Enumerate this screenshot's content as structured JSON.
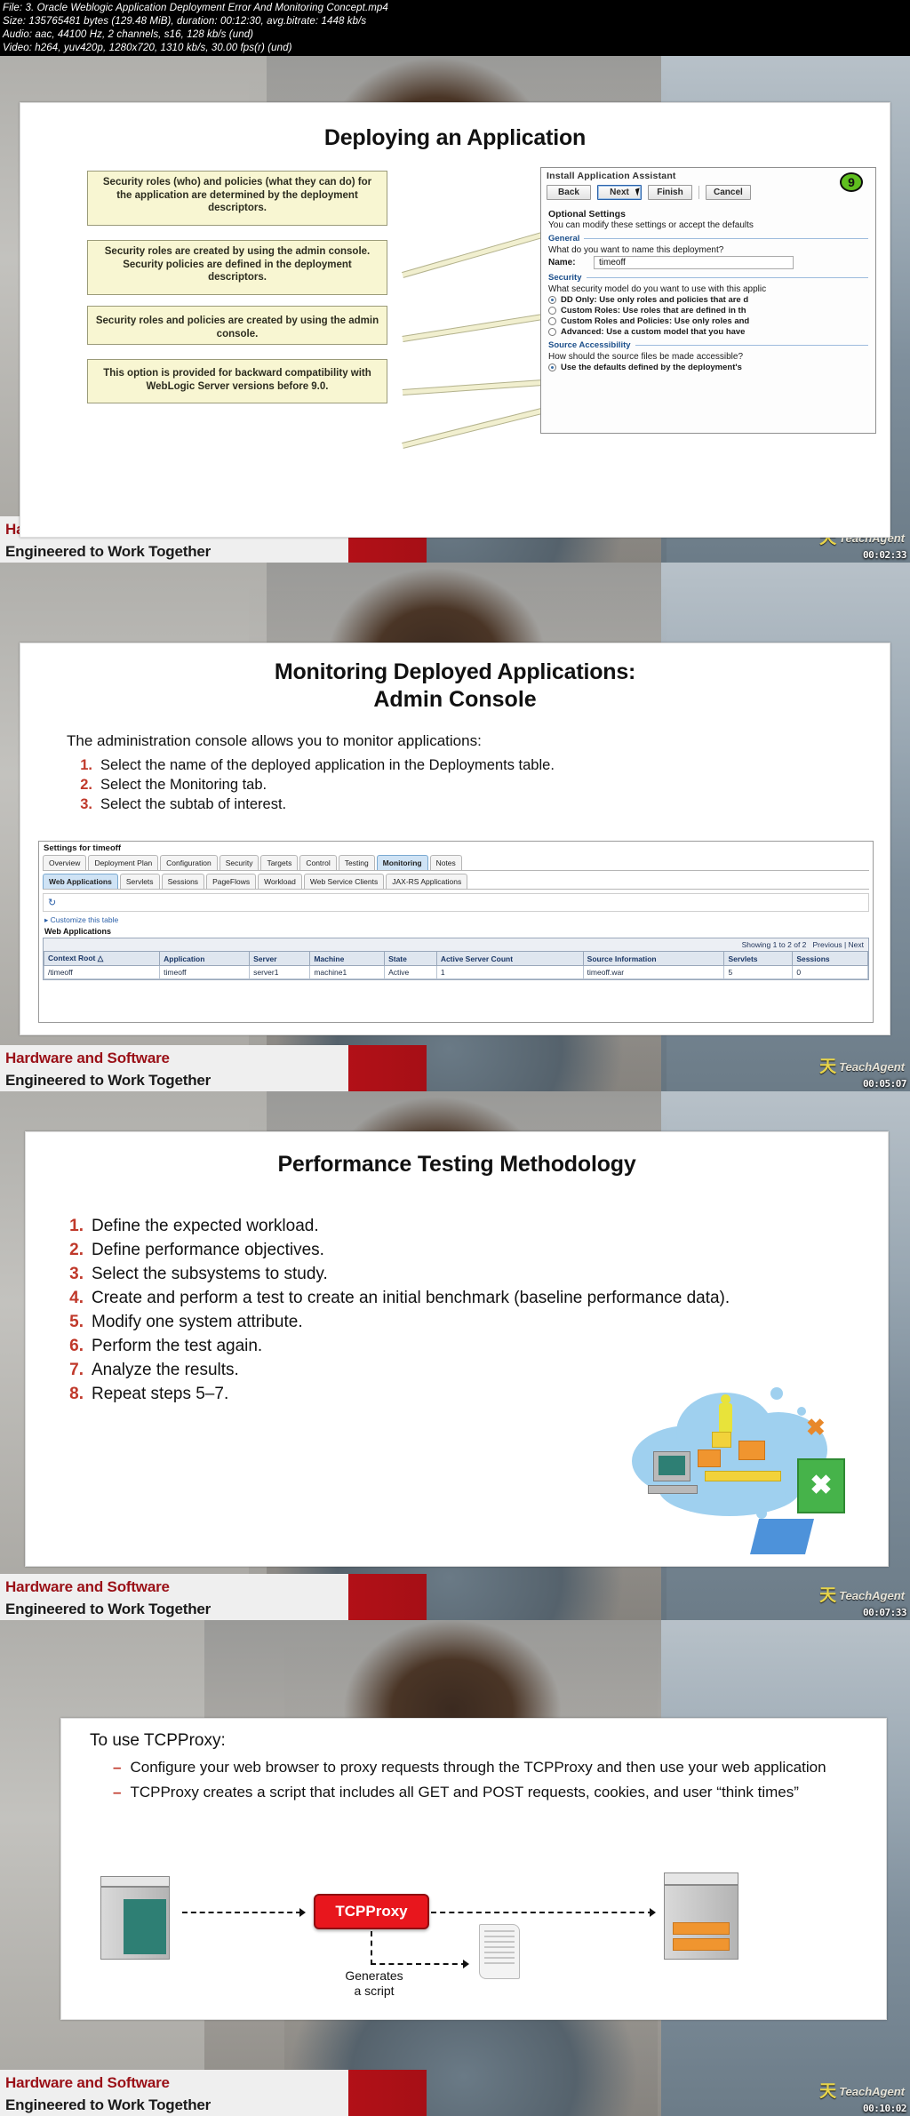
{
  "media_info": {
    "file": "File: 3. Oracle Weblogic Application Deployment Error And Monitoring Concept.mp4",
    "size": "Size: 135765481 bytes (129.48 MiB), duration: 00:12:30, avg.bitrate: 1448 kb/s",
    "audio": "Audio: aac, 44100 Hz, 2 channels, s16, 128 kb/s (und)",
    "video": "Video: h264, yuv420p, 1280x720, 1310 kb/s, 30.00 fps(r) (und)"
  },
  "branding": {
    "line1": "Hardware and Software",
    "line2": "Engineered to Work Together",
    "watermark_glyph": "天",
    "watermark_text": "TeachAgent",
    "accent_red": "#b4121b",
    "accent_green": "#5fbf1f"
  },
  "panels": [
    {
      "timestamp": "00:02:33"
    },
    {
      "timestamp": "00:05:07"
    },
    {
      "timestamp": "00:07:33"
    },
    {
      "timestamp": "00:10:02"
    }
  ],
  "slide1": {
    "title": "Deploying an Application",
    "callouts": [
      "Security roles (who) and policies (what they can do) for the application are determined by the deployment descriptors.",
      "Security roles are created by using the admin console. Security policies are defined in the deployment descriptors.",
      "Security roles and policies are created by using the admin console.",
      "This option is provided for backward compatibility with WebLogic Server versions before 9.0."
    ],
    "assistant": {
      "title": "Install Application Assistant",
      "buttons": [
        "Back",
        "Next",
        "Finish",
        "Cancel"
      ],
      "step_badge": "9",
      "heading": "Optional Settings",
      "subheading": "You can modify these settings or accept the defaults",
      "general_legend": "General",
      "general_question": "What do you want to name this deployment?",
      "name_label": "Name:",
      "name_value": "timeoff",
      "security_legend": "Security",
      "security_question": "What security model do you want to use with this applic",
      "security_options": [
        {
          "label": "DD Only: Use only roles and policies that are d",
          "selected": true
        },
        {
          "label": "Custom Roles: Use roles that are defined in th",
          "selected": false
        },
        {
          "label": "Custom Roles and Policies: Use only roles and",
          "selected": false
        },
        {
          "label": "Advanced: Use a custom model that you have",
          "selected": false
        }
      ],
      "source_legend": "Source Accessibility",
      "source_question": "How should the source files be made accessible?",
      "source_option": {
        "label": "Use the defaults defined by the deployment's",
        "selected": true
      }
    }
  },
  "slide2": {
    "title": "Monitoring Deployed Applications:",
    "subtitle": "Admin Console",
    "intro": "The administration console allows you to monitor applications:",
    "steps": [
      "Select the name of the deployed application in the Deployments table.",
      "Select the Monitoring tab.",
      "Select the subtab of interest."
    ],
    "console": {
      "title": "Settings for timeoff",
      "tabs": [
        "Overview",
        "Deployment Plan",
        "Configuration",
        "Security",
        "Targets",
        "Control",
        "Testing",
        "Monitoring",
        "Notes"
      ],
      "selected_tab": "Monitoring",
      "subtabs": [
        "Web Applications",
        "Servlets",
        "Sessions",
        "PageFlows",
        "Workload",
        "Web Service Clients",
        "JAX-RS Applications"
      ],
      "selected_subtab": "Web Applications",
      "customize_link": "Customize this table",
      "table_caption": "Web Applications",
      "showing": "Showing 1 to 2 of 2",
      "prev": "Previous",
      "next": "Next",
      "columns": [
        "Context Root",
        "Application",
        "Server",
        "Machine",
        "State",
        "Active Server Count",
        "Source Information",
        "Servlets",
        "Sessions"
      ],
      "rows": [
        [
          "/timeoff",
          "timeoff",
          "server1",
          "machine1",
          "Active",
          "1",
          "timeoff.war",
          "5",
          "0"
        ]
      ]
    }
  },
  "slide3": {
    "title": "Performance Testing Methodology",
    "steps": [
      "Define the expected workload.",
      "Define performance objectives.",
      "Select the subsystems to study.",
      "Create and perform a test to create an initial benchmark (baseline performance data).",
      "Modify one system attribute.",
      "Perform the test again.",
      "Analyze the results.",
      "Repeat steps 5–7."
    ]
  },
  "slide4": {
    "heading": "To use TCPProxy:",
    "bullets": [
      "Configure your web browser to proxy requests through the TCPProxy and then use your web application",
      "TCPProxy creates a script that includes all GET and POST requests, cookies, and user “think times”"
    ],
    "diagram": {
      "proxy_label": "TCPProxy",
      "generates_label": "Generates\na script"
    }
  }
}
